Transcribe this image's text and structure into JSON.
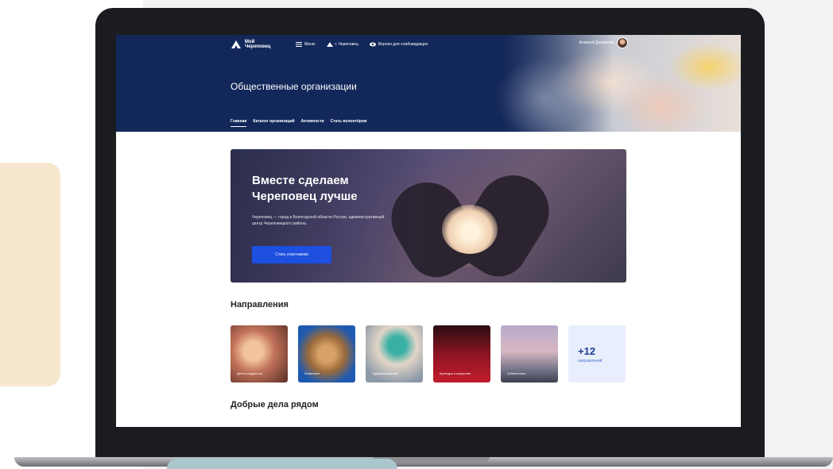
{
  "site": {
    "logo_line1": "Мой",
    "logo_line2": "Череповец",
    "nav": [
      {
        "label": "Меню",
        "icon": "menu-icon"
      },
      {
        "label": "г. Череповец",
        "icon": "city-icon"
      },
      {
        "label": "Версия для слабовидящих",
        "icon": "eye-icon"
      }
    ],
    "user_name": "Алексей Долматов"
  },
  "header": {
    "title": "Общественные организации",
    "tabs": [
      "Главная",
      "Каталог организаций",
      "Активности",
      "Стать волонтёром"
    ]
  },
  "hero": {
    "title": "Вместе сделаем Череповец лучше",
    "text": "Череповец — город в Вологодской области России, административный центр Череповецкого района.",
    "button": "Стать участником"
  },
  "directions": {
    "title": "Направления",
    "items": [
      {
        "label": "Дети и подростки"
      },
      {
        "label": "Животные"
      },
      {
        "label": "Здравоохранение"
      },
      {
        "label": "Культура и искусство"
      },
      {
        "label": "Урбанистика"
      }
    ],
    "more_count": "+12",
    "more_label": "направлений"
  },
  "nearby": {
    "title": "Добрые дела рядом"
  },
  "colors": {
    "header_bg": "#13285a",
    "accent": "#1d4fe0"
  }
}
